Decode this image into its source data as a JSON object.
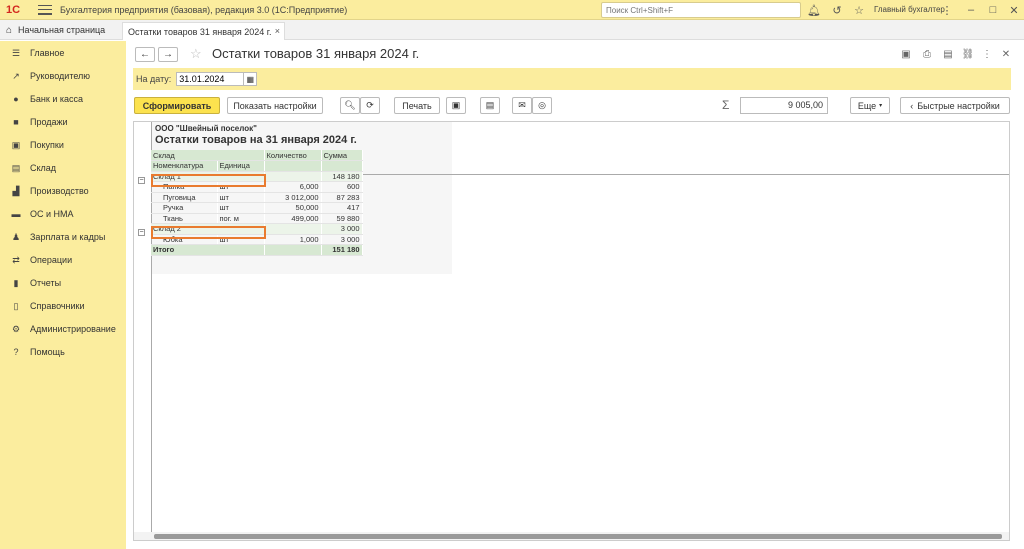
{
  "app": {
    "logo_text": "1С",
    "title": "Бухгалтерия предприятия (базовая), редакция 3.0  (1С:Предприятие)",
    "search_placeholder": "Поиск Ctrl+Shift+F",
    "user": "Главный бухгалтер"
  },
  "tabs": {
    "home": "Начальная страница",
    "doc": "Остатки товаров 31 января 2024 г."
  },
  "sidebar": {
    "items": [
      {
        "label": "Главное",
        "icon": "menu-icon"
      },
      {
        "label": "Руководителю",
        "icon": "trend-icon"
      },
      {
        "label": "Банк и касса",
        "icon": "bank-icon"
      },
      {
        "label": "Продажи",
        "icon": "bag-icon"
      },
      {
        "label": "Покупки",
        "icon": "cart-icon"
      },
      {
        "label": "Склад",
        "icon": "warehouse-icon"
      },
      {
        "label": "Производство",
        "icon": "factory-icon"
      },
      {
        "label": "ОС и НМА",
        "icon": "truck-icon"
      },
      {
        "label": "Зарплата и кадры",
        "icon": "people-icon"
      },
      {
        "label": "Операции",
        "icon": "operations-icon"
      },
      {
        "label": "Отчеты",
        "icon": "chart-icon"
      },
      {
        "label": "Справочники",
        "icon": "book-icon"
      },
      {
        "label": "Администрирование",
        "icon": "gear-icon"
      },
      {
        "label": "Помощь",
        "icon": "help-icon"
      }
    ]
  },
  "page": {
    "title": "Остатки товаров 31 января 2024 г.",
    "date_label": "На дату:",
    "date_value": "31.01.2024"
  },
  "toolbar": {
    "generate": "Сформировать",
    "show_settings": "Показать настройки",
    "print": "Печать",
    "sum_value": "9 005,00",
    "more": "Еще",
    "quick_settings": "Быстрые настройки"
  },
  "report": {
    "org": "ООО \"Швейный поселок\"",
    "title": "Остатки товаров на 31 января 2024 г.",
    "headers": {
      "warehouse": "Склад",
      "item": "Номенклатура",
      "unit": "Единица",
      "qty": "Количество",
      "sum": "Сумма"
    },
    "groups": [
      {
        "name": "Склад 1",
        "sum": "148 180",
        "rows": [
          {
            "item": "Папка",
            "unit": "шт",
            "qty": "6,000",
            "sum": "600"
          },
          {
            "item": "Пуговица",
            "unit": "шт",
            "qty": "3 012,000",
            "sum": "87 283"
          },
          {
            "item": "Ручка",
            "unit": "шт",
            "qty": "50,000",
            "sum": "417"
          },
          {
            "item": "Ткань",
            "unit": "пог. м",
            "qty": "499,000",
            "sum": "59 880"
          }
        ]
      },
      {
        "name": "Склад 2",
        "sum": "3 000",
        "rows": [
          {
            "item": "Юбка",
            "unit": "шт",
            "qty": "1,000",
            "sum": "3 000"
          }
        ]
      }
    ],
    "total_label": "Итого",
    "total_sum": "151 180"
  },
  "colors": {
    "accent_yellow": "#fbed9e",
    "button_yellow": "#fce24e",
    "header_green": "#d7e8d2",
    "highlight_orange": "#e97b2f"
  }
}
